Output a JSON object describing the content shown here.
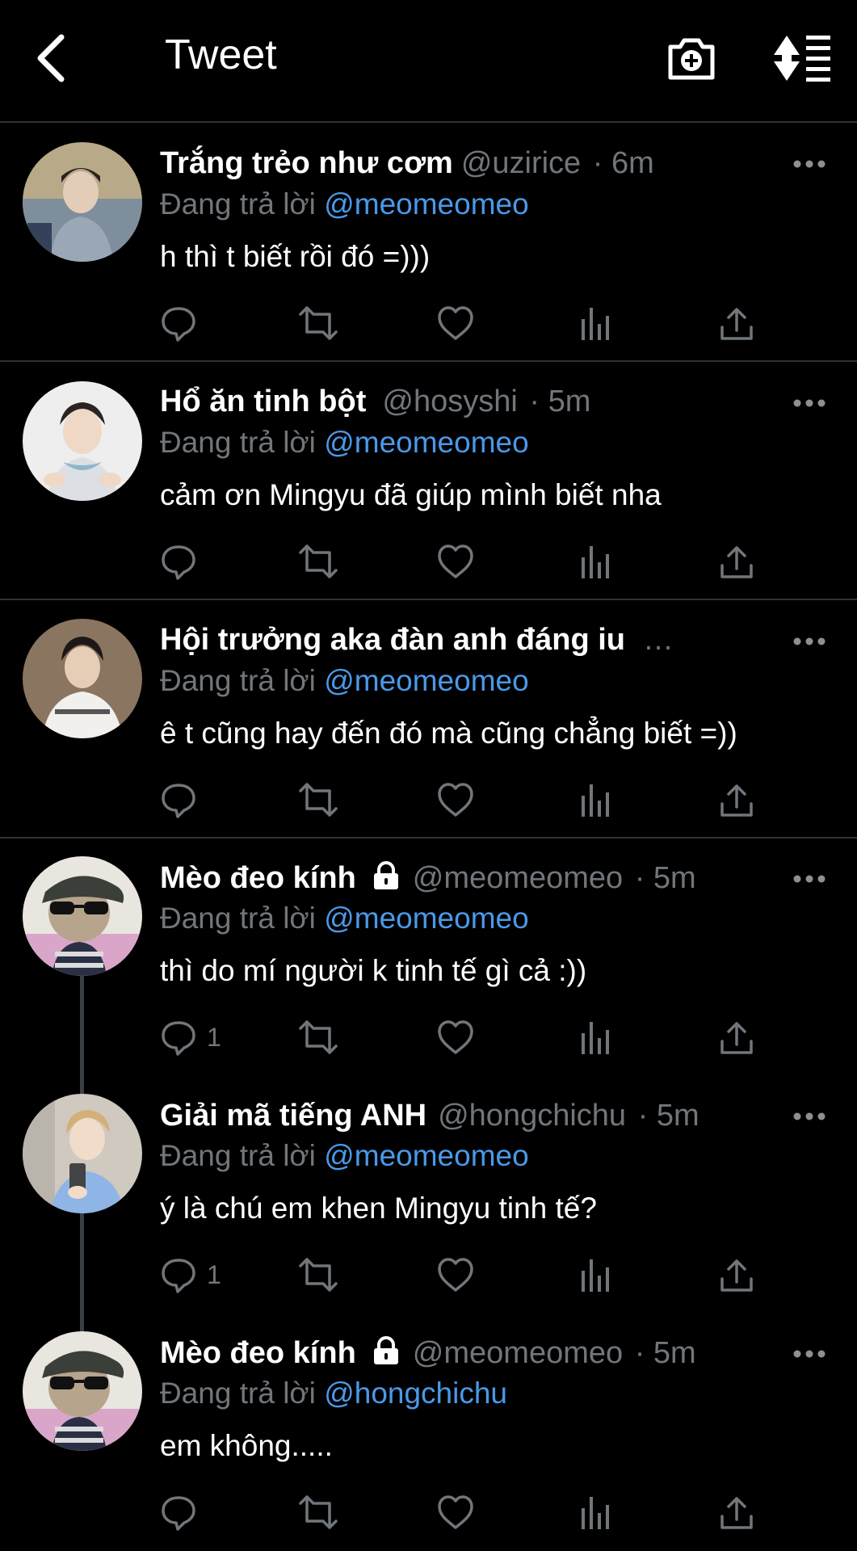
{
  "header": {
    "title": "Tweet"
  },
  "replying_prefix": "Đang trả lời",
  "tweets": [
    {
      "name": "Trắng trẻo như cơm",
      "handle": "@uzirice",
      "time": "· 6m",
      "locked": false,
      "reply_to": "@meomeomeo",
      "text": "h thì t biết rồi đó =)))",
      "reply_count": ""
    },
    {
      "name": "Hổ ăn tinh bột",
      "handle": "@hosyshi",
      "time": "· 5m",
      "locked": false,
      "reply_to": "@meomeomeo",
      "text": "cảm ơn Mingyu đã giúp mình biết nha",
      "reply_count": ""
    },
    {
      "name": "Hội trưởng aka đàn anh đáng iu",
      "handle": "…",
      "time": "",
      "locked": false,
      "reply_to": "@meomeomeo",
      "text": "ê t cũng hay đến đó mà cũng chẳng biết =))",
      "reply_count": ""
    },
    {
      "name": "Mèo đeo kính",
      "handle": "@meomeomeo",
      "time": "· 5m",
      "locked": true,
      "reply_to": "@meomeomeo",
      "text": "thì do mí người k tinh tế gì cả :))",
      "reply_count": "1"
    },
    {
      "name": "Giải mã tiếng ANH",
      "handle": "@hongchichu",
      "time": "· 5m",
      "locked": false,
      "reply_to": "@meomeomeo",
      "text": "ý là chú em khen Mingyu tinh tế?",
      "reply_count": "1"
    },
    {
      "name": "Mèo đeo kính",
      "handle": "@meomeomeo",
      "time": "· 5m",
      "locked": true,
      "reply_to": "@hongchichu",
      "text": "em không.....",
      "reply_count": ""
    }
  ],
  "colors": {
    "background": "#000000",
    "text": "#ffffff",
    "secondary": "#71767b",
    "accent": "#4a99e9",
    "divider": "#2f3336"
  },
  "icons": [
    "back-arrow-icon",
    "camera-plus-icon",
    "sort-icon",
    "more-icon",
    "reply-icon",
    "retweet-icon",
    "like-icon",
    "analytics-icon",
    "share-icon",
    "lock-icon"
  ]
}
